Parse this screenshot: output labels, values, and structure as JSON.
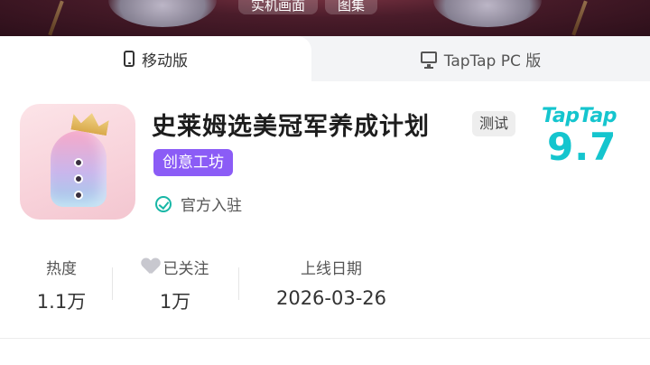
{
  "banner": {
    "tabs": [
      {
        "label": "实机画面"
      },
      {
        "label": "图集"
      }
    ]
  },
  "platform_tabs": {
    "mobile": {
      "label": "移动版",
      "icon": "phone-icon"
    },
    "pc": {
      "label": "TapTap PC 版",
      "icon": "monitor-icon"
    }
  },
  "app": {
    "title": "史莱姆选美冠军养成计划",
    "status_tag": "测试",
    "category_tag": "创意工坊",
    "official_label": "官方入驻",
    "rating_brand": "TapTap",
    "rating_score": "9.7"
  },
  "stats": {
    "heat": {
      "label": "热度",
      "value": "1.1万"
    },
    "follow": {
      "label": "已关注",
      "value": "1万"
    },
    "launch": {
      "label": "上线日期",
      "value": "2026-03-26"
    }
  },
  "colors": {
    "accent_teal": "#15c5ce",
    "category_purple": "#8b5cf6",
    "verified_teal": "#18b7a6"
  }
}
